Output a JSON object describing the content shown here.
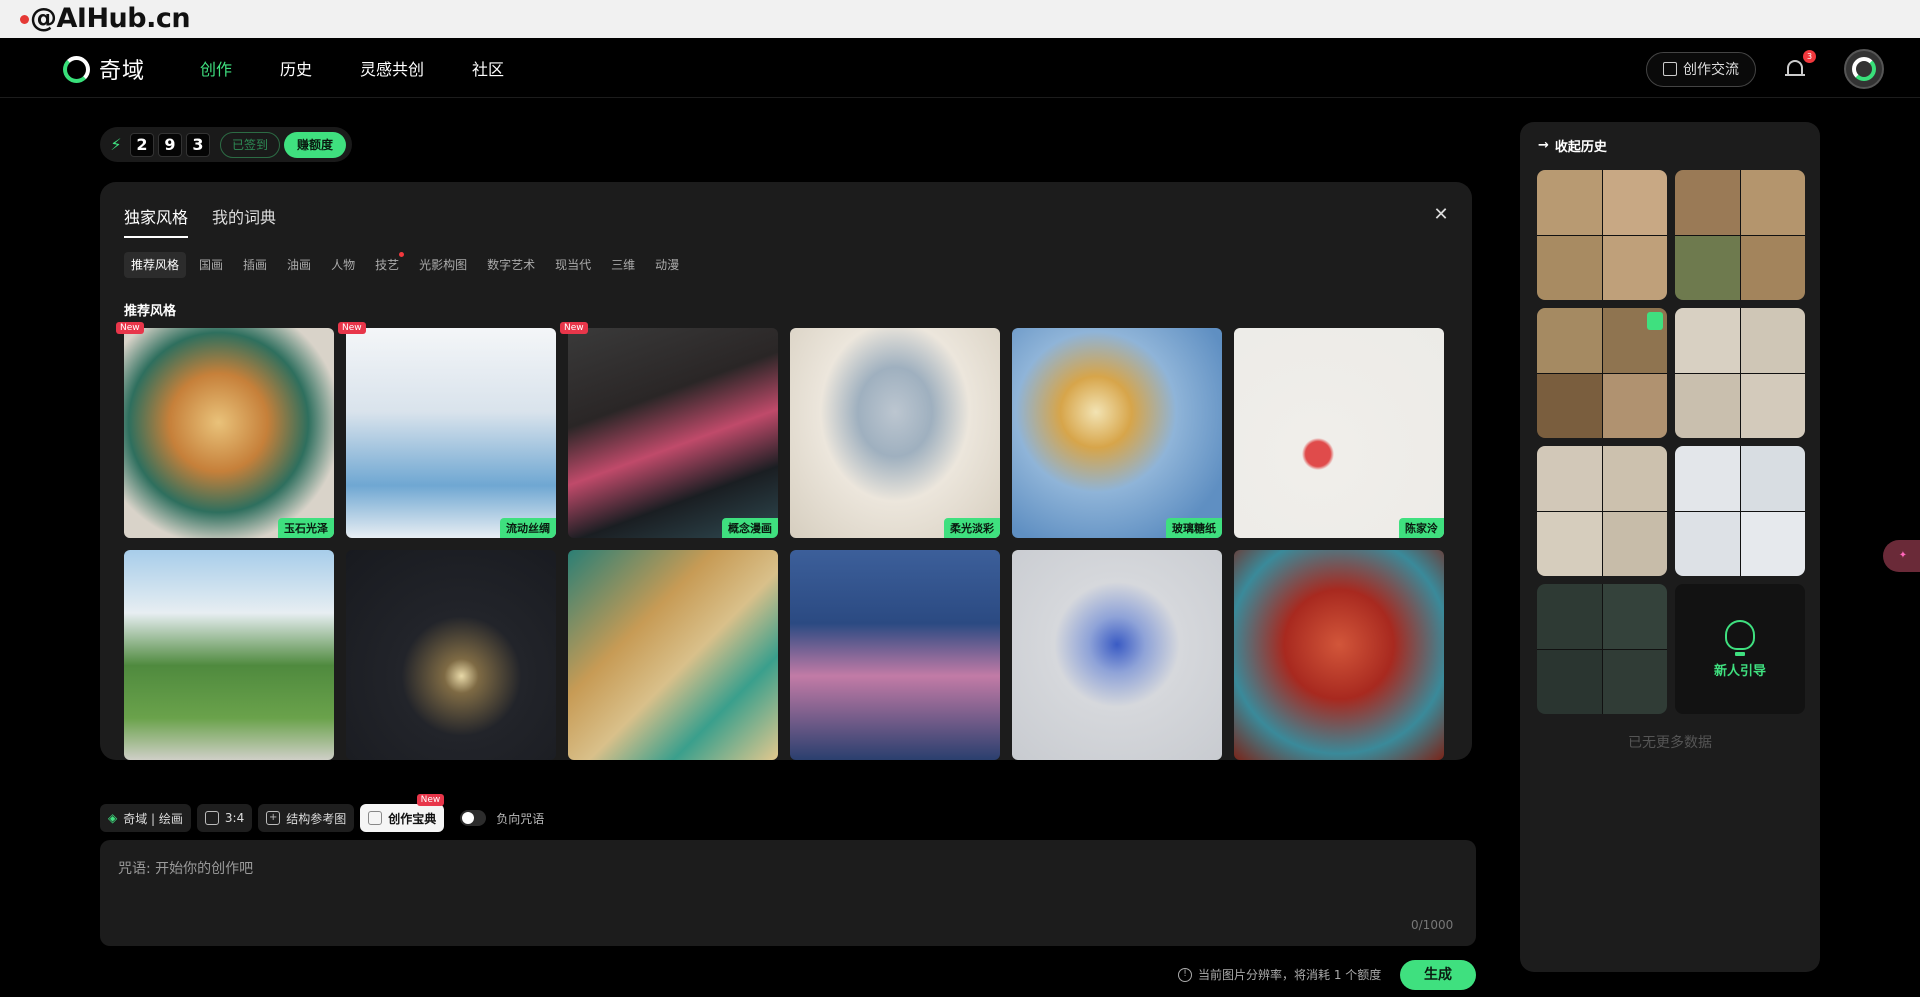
{
  "watermark": "@AIHub.cn",
  "header": {
    "logo_text": "奇域",
    "nav": [
      "创作",
      "历史",
      "灵感共创",
      "社区"
    ],
    "exchange_label": "创作交流",
    "notification_count": "3"
  },
  "credits": {
    "digits": [
      "2",
      "9",
      "3"
    ],
    "signed_label": "已签到",
    "earn_label": "赚额度"
  },
  "style_panel": {
    "tabs": [
      "独家风格",
      "我的词典"
    ],
    "categories": [
      "推荐风格",
      "国画",
      "插画",
      "油画",
      "人物",
      "技艺",
      "光影构图",
      "数字艺术",
      "现当代",
      "三维",
      "动漫"
    ],
    "section_title": "推荐风格",
    "new_tag": "New",
    "tiles": [
      {
        "label": "玉石光泽",
        "is_new": true
      },
      {
        "label": "流动丝绸",
        "is_new": true
      },
      {
        "label": "概念漫画",
        "is_new": true
      },
      {
        "label": "柔光淡彩",
        "is_new": false
      },
      {
        "label": "玻璃糖纸",
        "is_new": false
      },
      {
        "label": "陈家泠",
        "is_new": false
      },
      {
        "label": "",
        "is_new": false
      },
      {
        "label": "",
        "is_new": false
      },
      {
        "label": "",
        "is_new": false
      },
      {
        "label": "",
        "is_new": false
      },
      {
        "label": "",
        "is_new": false
      },
      {
        "label": "",
        "is_new": false
      }
    ]
  },
  "toolbar": {
    "model_label": "奇域 | 绘画",
    "ratio_label": "3:4",
    "reference_label": "结构参考图",
    "guide_label": "创作宝典",
    "guide_new_tag": "New",
    "negative_label": "负向咒语"
  },
  "prompt": {
    "placeholder": "咒语: 开始你的创作吧",
    "counter": "0/1000"
  },
  "footer": {
    "note": "当前图片分辨率，将消耗 1 个额度",
    "generate_label": "生成"
  },
  "history": {
    "title": "收起历史",
    "guide_label": "新人引导",
    "no_more": "已无更多数据"
  }
}
